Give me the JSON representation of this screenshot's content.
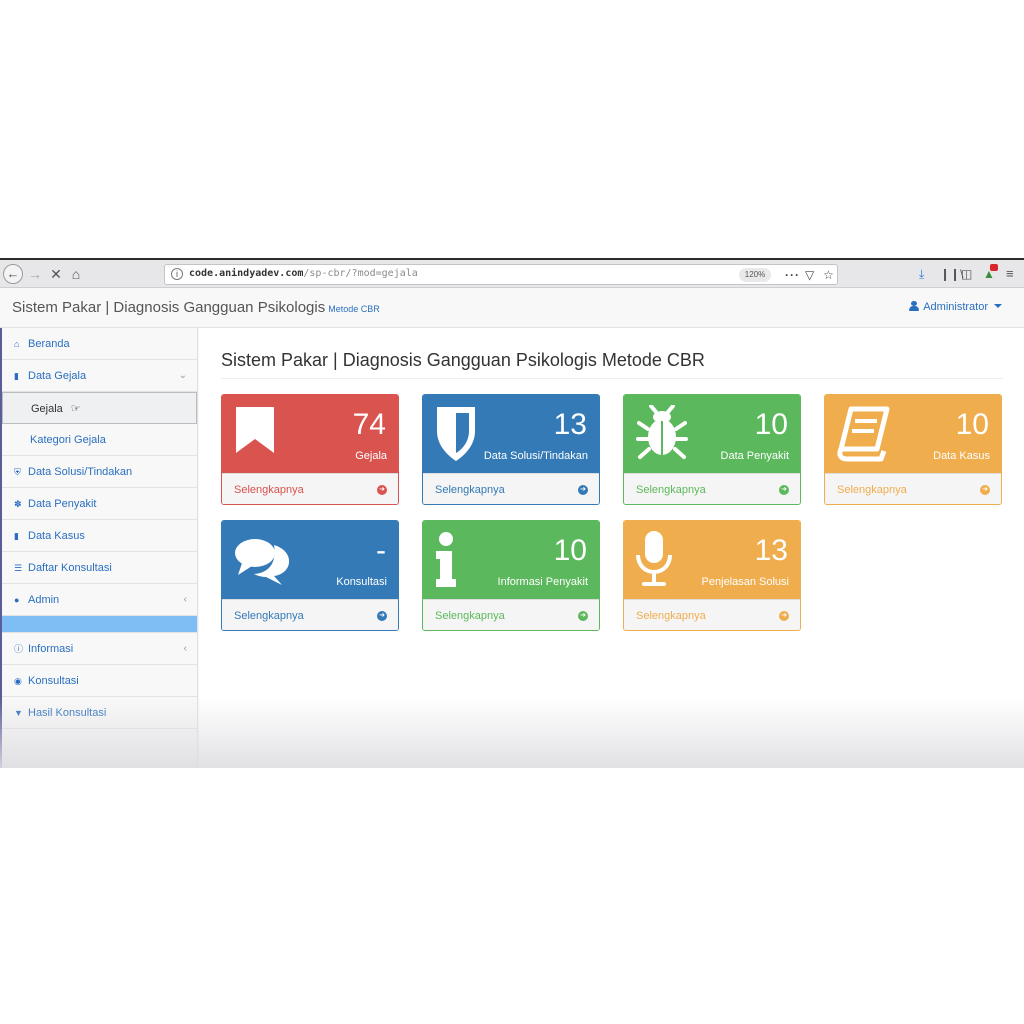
{
  "browser": {
    "url_host": "code.anindyadev.com",
    "url_path": "/sp-cbr/?mod=gejala",
    "url_scheme": "",
    "zoom": "120%"
  },
  "navbar": {
    "brand": "Sistem Pakar | Diagnosis Gangguan Psikologis",
    "brand_sub": "Metode CBR",
    "user": "Administrator"
  },
  "sidebar": {
    "items": [
      {
        "label": "Beranda",
        "icon": "home-icon"
      },
      {
        "label": "Data Gejala",
        "icon": "bookmark-icon"
      },
      {
        "label": "Gejala"
      },
      {
        "label": "Kategori Gejala"
      },
      {
        "label": "Data Solusi/Tindakan",
        "icon": "shield-icon"
      },
      {
        "label": "Data Penyakit",
        "icon": "bug-icon"
      },
      {
        "label": "Data Kasus",
        "icon": "book-icon"
      },
      {
        "label": "Daftar Konsultasi",
        "icon": "list-icon"
      },
      {
        "label": "Admin",
        "icon": "user-circle-icon"
      },
      {
        "label": "Informasi",
        "icon": "info-icon"
      },
      {
        "label": "Konsultasi",
        "icon": "comments-icon"
      },
      {
        "label": "Hasil Konsultasi",
        "icon": "glass-icon"
      }
    ]
  },
  "main": {
    "title": "Sistem Pakar | Diagnosis Gangguan Psikologis Metode CBR",
    "cards": [
      {
        "value": "74",
        "label": "Gejala",
        "link": "Selengkapnya",
        "color": "#d9534f",
        "icon": "bookmark-icon"
      },
      {
        "value": "13",
        "label": "Data Solusi/Tindakan",
        "link": "Selengkapnya",
        "color": "#337ab7",
        "icon": "shield-icon"
      },
      {
        "value": "10",
        "label": "Data Penyakit",
        "link": "Selengkapnya",
        "color": "#5cb85c",
        "icon": "bug-icon"
      },
      {
        "value": "10",
        "label": "Data Kasus",
        "link": "Selengkapnya",
        "color": "#f0ad4e",
        "icon": "book-icon"
      },
      {
        "value": "-",
        "label": "Konsultasi",
        "link": "Selengkapnya",
        "color": "#337ab7",
        "icon": "comments-icon"
      },
      {
        "value": "10",
        "label": "Informasi Penyakit",
        "link": "Selengkapnya",
        "color": "#5cb85c",
        "icon": "info-icon"
      },
      {
        "value": "13",
        "label": "Penjelasan Solusi",
        "link": "Selengkapnya",
        "color": "#f0ad4e",
        "icon": "microphone-icon"
      }
    ]
  }
}
